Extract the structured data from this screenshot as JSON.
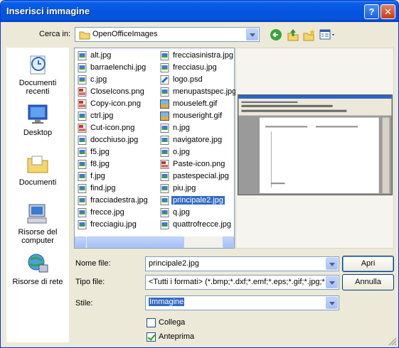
{
  "window": {
    "title": "Inserisci immagine",
    "help": "?",
    "close": "✕"
  },
  "lookin": {
    "label": "Cerca in:",
    "value": "OpenOfficeImages"
  },
  "places": [
    {
      "label": "Documenti recenti",
      "icon": "recent-documents-icon"
    },
    {
      "label": "Desktop",
      "icon": "desktop-icon"
    },
    {
      "label": "Documenti",
      "icon": "documents-folder-icon"
    },
    {
      "label": "Risorse del computer",
      "icon": "my-computer-icon"
    },
    {
      "label": "Risorse di rete",
      "icon": "network-places-icon"
    }
  ],
  "files_col1": [
    {
      "name": "alt.jpg",
      "type": "jpg"
    },
    {
      "name": "barraelenchi.jpg",
      "type": "jpg"
    },
    {
      "name": "c.jpg",
      "type": "jpg"
    },
    {
      "name": "CloseIcons.png",
      "type": "png"
    },
    {
      "name": "Copy-icon.png",
      "type": "png"
    },
    {
      "name": "ctrl.jpg",
      "type": "jpg"
    },
    {
      "name": "Cut-icon.png",
      "type": "png"
    },
    {
      "name": "docchiuso.jpg",
      "type": "jpg"
    },
    {
      "name": "f5.jpg",
      "type": "jpg"
    },
    {
      "name": "f8.jpg",
      "type": "jpg"
    },
    {
      "name": "f.jpg",
      "type": "jpg"
    },
    {
      "name": "find.jpg",
      "type": "jpg"
    },
    {
      "name": "fracciadestra.jpg",
      "type": "jpg"
    },
    {
      "name": "frecce.jpg",
      "type": "jpg"
    },
    {
      "name": "frecciagiu.jpg",
      "type": "jpg"
    }
  ],
  "files_col2": [
    {
      "name": "frecciasinistra.jpg",
      "type": "jpg"
    },
    {
      "name": "frecciasu.jpg",
      "type": "jpg"
    },
    {
      "name": "logo.psd",
      "type": "psd"
    },
    {
      "name": "menupastspec.jpg",
      "type": "jpg"
    },
    {
      "name": "mouseleft.gif",
      "type": "gif"
    },
    {
      "name": "mouseright.gif",
      "type": "gif"
    },
    {
      "name": "n.jpg",
      "type": "jpg"
    },
    {
      "name": "navigatore.jpg",
      "type": "jpg"
    },
    {
      "name": "o.jpg",
      "type": "jpg"
    },
    {
      "name": "Paste-icon.png",
      "type": "png"
    },
    {
      "name": "pastespecial.jpg",
      "type": "jpg"
    },
    {
      "name": "piu.jpg",
      "type": "jpg"
    },
    {
      "name": "principale2.jpg",
      "type": "jpg",
      "selected": true
    },
    {
      "name": "q.jpg",
      "type": "jpg"
    },
    {
      "name": "quattrofrecce.jpg",
      "type": "jpg"
    }
  ],
  "form": {
    "filename_label": "Nome file:",
    "filename_value": "principale2.jpg",
    "filetype_label": "Tipo file:",
    "filetype_value": "<Tutti i formati> (*.bmp;*.dxf;*.emf;*.eps;*.gif;*.jpg;*.jpe",
    "style_label": "Stile:",
    "style_value": "Immagine",
    "open_btn": "Apri",
    "cancel_btn": "Annulla",
    "link_label": "Collega",
    "link_checked": false,
    "preview_label": "Anteprima",
    "preview_checked": true
  },
  "colors": {
    "title_bar": "#0555e0",
    "selection": "#316ac5",
    "dialog_bg": "#ece9d8"
  }
}
